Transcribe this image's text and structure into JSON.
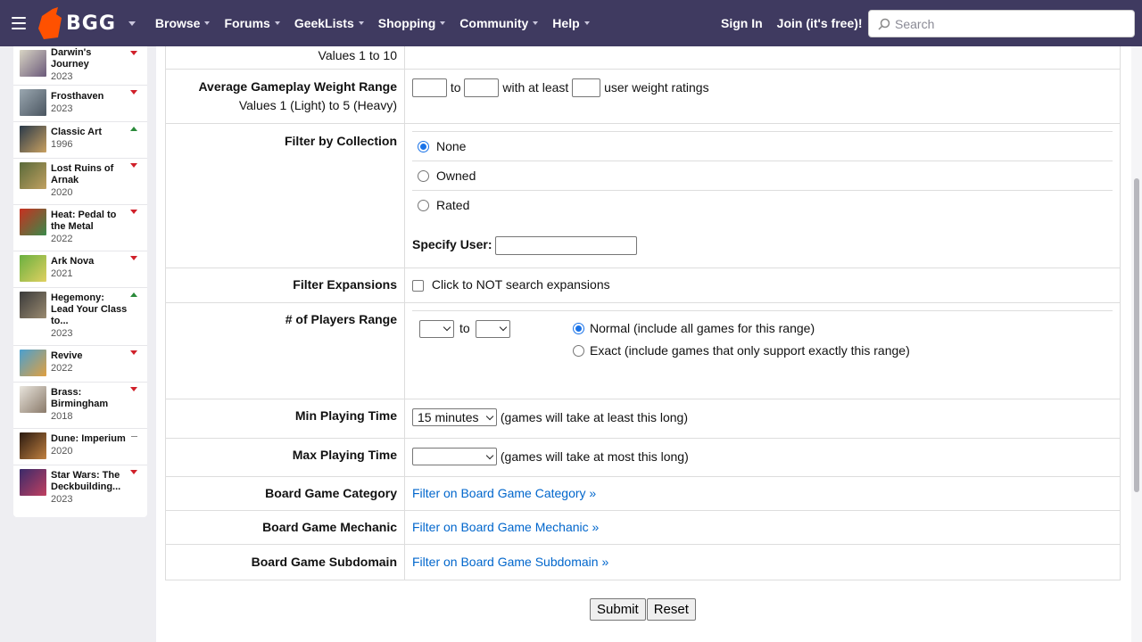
{
  "header": {
    "brand": "BGG",
    "nav": [
      "Browse",
      "Forums",
      "GeekLists",
      "Shopping",
      "Community",
      "Help"
    ],
    "sign_in": "Sign In",
    "join": "Join (it's free)!",
    "search_placeholder": "Search",
    "colors": {
      "bar": "#3f3a60",
      "logo": "#ff5100"
    }
  },
  "sidebar": {
    "items": [
      {
        "name_line1": "Darwin's",
        "name_line2": "Journey",
        "year": "2023",
        "trend": "down",
        "thumb": [
          "#d8d4c4",
          "#6b5a7a"
        ]
      },
      {
        "name_line1": "Frosthaven",
        "name_line2": "",
        "year": "2023",
        "trend": "down",
        "thumb": [
          "#9aa7b0",
          "#4a5560"
        ]
      },
      {
        "name_line1": "Classic Art",
        "name_line2": "",
        "year": "1996",
        "trend": "up",
        "thumb": [
          "#2a3a4a",
          "#c8a060"
        ]
      },
      {
        "name_line1": "Lost Ruins of",
        "name_line2": "Arnak",
        "year": "2020",
        "trend": "down",
        "thumb": [
          "#5a6a3a",
          "#c0a060"
        ]
      },
      {
        "name_line1": "Heat: Pedal to",
        "name_line2": "the Metal",
        "year": "2022",
        "trend": "down",
        "thumb": [
          "#c83020",
          "#3a8a4a"
        ]
      },
      {
        "name_line1": "Ark Nova",
        "name_line2": "",
        "year": "2021",
        "trend": "down",
        "thumb": [
          "#6ab040",
          "#e0d060"
        ]
      },
      {
        "name_line1": "Hegemony:",
        "name_line2": "Lead Your Class",
        "name_line3": "to...",
        "year": "2023",
        "trend": "up",
        "thumb": [
          "#3a3a3a",
          "#9a8a70"
        ]
      },
      {
        "name_line1": "Revive",
        "name_line2": "",
        "year": "2022",
        "trend": "down",
        "thumb": [
          "#4aa0d0",
          "#e0a040"
        ]
      },
      {
        "name_line1": "Brass:",
        "name_line2": "Birmingham",
        "year": "2018",
        "trend": "down",
        "thumb": [
          "#e8e4dc",
          "#8a7a6a"
        ]
      },
      {
        "name_line1": "Dune: Imperium",
        "name_line2": "",
        "year": "2020",
        "trend": "flat",
        "thumb": [
          "#2a1a10",
          "#c08040"
        ]
      },
      {
        "name_line1": "Star Wars: The",
        "name_line2": "Deckbuilding...",
        "year": "2023",
        "trend": "down",
        "thumb": [
          "#3a2a6a",
          "#c04060"
        ]
      }
    ]
  },
  "form": {
    "rating_sub": "Values 1 to 10",
    "weight_label": "Average Gameplay Weight Range",
    "weight_sub": "Values 1 (Light) to 5 (Heavy)",
    "weight_to": "to",
    "weight_atleast": "with at least",
    "weight_suffix": "user weight ratings",
    "collection_label": "Filter by Collection",
    "collection_options": [
      "None",
      "Owned",
      "Rated"
    ],
    "collection_selected": "None",
    "specify_user": "Specify User:",
    "expansions_label": "Filter Expansions",
    "expansions_text": "Click to NOT search expansions",
    "players_label": "# of Players Range",
    "players_to": "to",
    "players_normal": "Normal (include all games for this range)",
    "players_exact": "Exact (include games that only support exactly this range)",
    "players_mode_selected": "Normal",
    "min_time_label": "Min Playing Time",
    "min_time_value": "15 minutes",
    "min_time_note": "(games will take at least this long)",
    "max_time_label": "Max Playing Time",
    "max_time_value": "",
    "max_time_note": "(games will take at most this long)",
    "category_label": "Board Game Category",
    "category_link": "Filter on Board Game Category »",
    "mechanic_label": "Board Game Mechanic",
    "mechanic_link": "Filter on Board Game Mechanic »",
    "subdomain_label": "Board Game Subdomain",
    "subdomain_link": "Filter on Board Game Subdomain »",
    "submit": "Submit",
    "reset": "Reset"
  }
}
